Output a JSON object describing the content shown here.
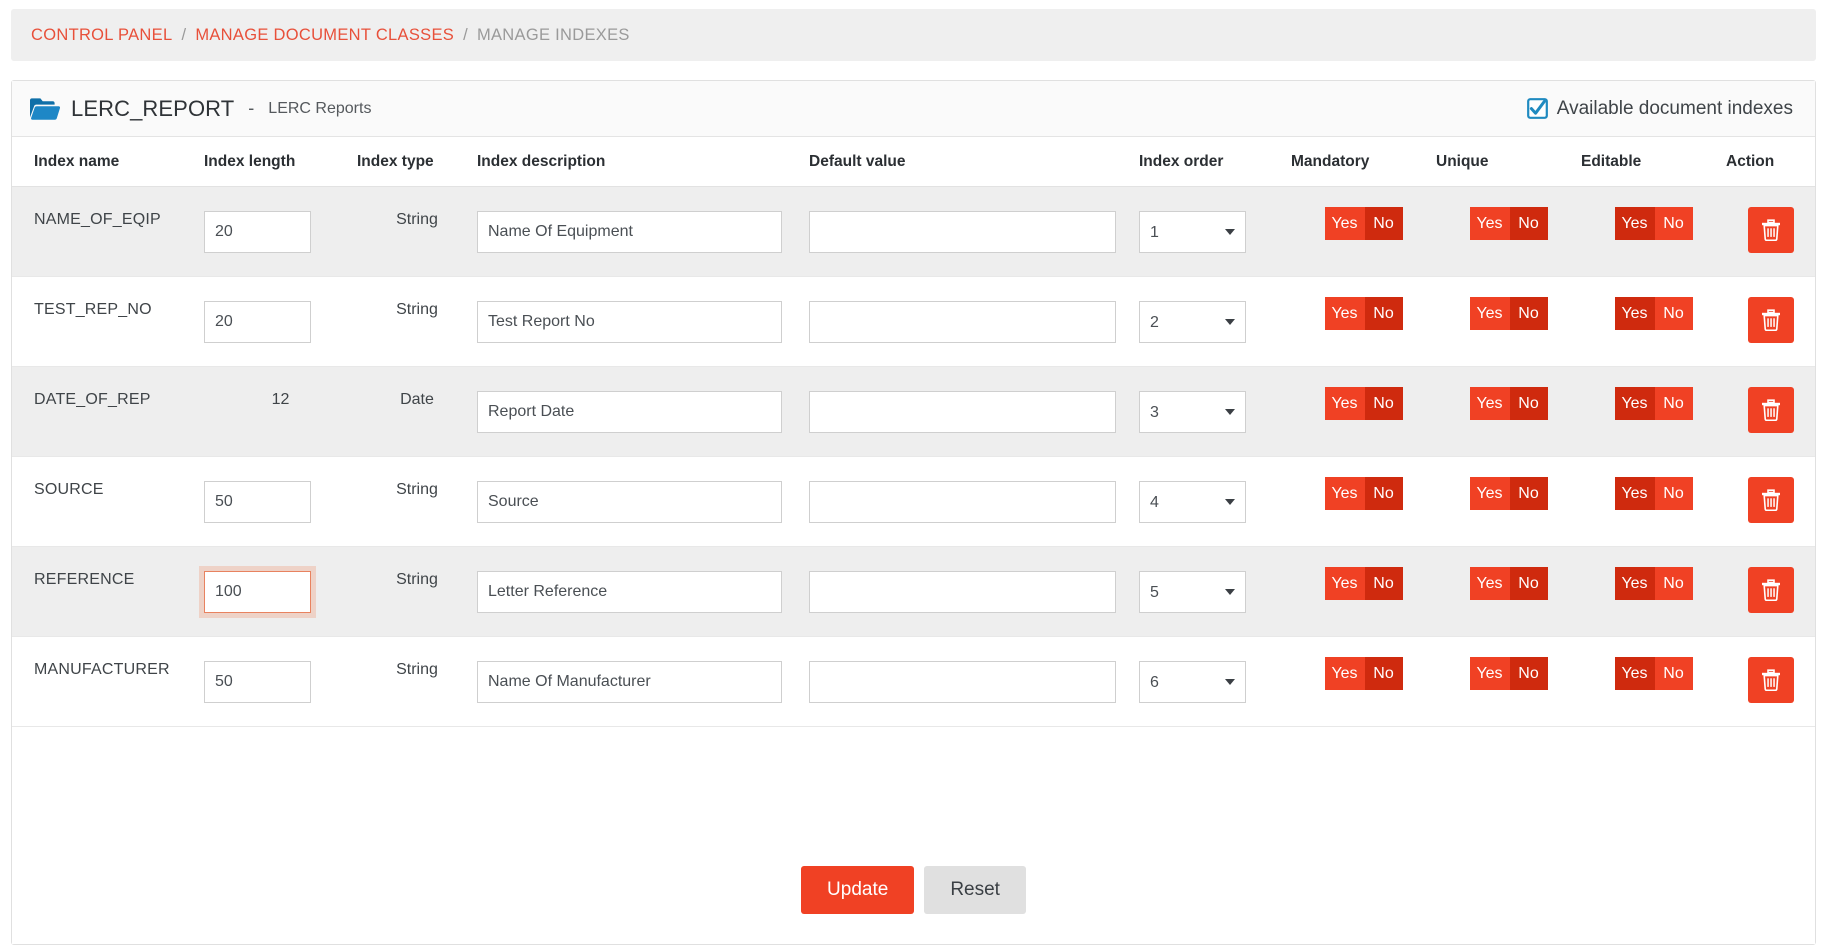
{
  "breadcrumb": {
    "items": [
      {
        "label": "CONTROL PANEL",
        "active": false
      },
      {
        "label": "MANAGE DOCUMENT CLASSES",
        "active": false
      },
      {
        "label": "MANAGE INDEXES",
        "active": true
      }
    ],
    "separator": "/"
  },
  "panel": {
    "folder_icon": "folder-open-icon",
    "title_code": "LERC_REPORT",
    "title_dash": "-",
    "title_name": "LERC Reports",
    "available_label": "Available document indexes",
    "available_icon": "checkbox-checked-icon"
  },
  "table": {
    "columns": [
      "Index name",
      "Index length",
      "Index type",
      "Index description",
      "Default value",
      "Index order",
      "Mandatory",
      "Unique",
      "Editable",
      "Action"
    ],
    "yes_label": "Yes",
    "no_label": "No",
    "order_options": [
      "1",
      "2",
      "3",
      "4",
      "5",
      "6"
    ],
    "delete_icon": "trash-icon",
    "rows": [
      {
        "name": "NAME_OF_EQIP",
        "length": "20",
        "length_editable": true,
        "type": "String",
        "description": "Name Of Equipment",
        "default_value": "",
        "order": "1",
        "mandatory": "No",
        "unique": "No",
        "editable": "Yes",
        "focused_length": false
      },
      {
        "name": "TEST_REP_NO",
        "length": "20",
        "length_editable": true,
        "type": "String",
        "description": "Test Report No",
        "default_value": "",
        "order": "2",
        "mandatory": "No",
        "unique": "No",
        "editable": "Yes",
        "focused_length": false
      },
      {
        "name": "DATE_OF_REP",
        "length": "12",
        "length_editable": false,
        "type": "Date",
        "description": "Report Date",
        "default_value": "",
        "order": "3",
        "mandatory": "No",
        "unique": "No",
        "editable": "Yes",
        "focused_length": false
      },
      {
        "name": "SOURCE",
        "length": "50",
        "length_editable": true,
        "type": "String",
        "description": "Source",
        "default_value": "",
        "order": "4",
        "mandatory": "No",
        "unique": "No",
        "editable": "Yes",
        "focused_length": false
      },
      {
        "name": "REFERENCE",
        "length": "100",
        "length_editable": true,
        "type": "String",
        "description": "Letter Reference",
        "default_value": "",
        "order": "5",
        "mandatory": "No",
        "unique": "No",
        "editable": "Yes",
        "focused_length": true
      },
      {
        "name": "MANUFACTURER",
        "length": "50",
        "length_editable": true,
        "type": "String",
        "description": "Name Of Manufacturer",
        "default_value": "",
        "order": "6",
        "mandatory": "No",
        "unique": "No",
        "editable": "Yes",
        "focused_length": false
      }
    ]
  },
  "footer": {
    "update_label": "Update",
    "reset_label": "Reset"
  },
  "colors": {
    "accent_red": "#f04124",
    "accent_red_dark": "#cf2a0e",
    "breadcrumb_link": "#e8503a",
    "breadcrumb_muted": "#9a9a9a",
    "folder_blue": "#1f7fb5",
    "checkbox_blue": "#1f8ac0",
    "row_stripe": "#eeeeee",
    "focus_border": "#e8825f"
  }
}
